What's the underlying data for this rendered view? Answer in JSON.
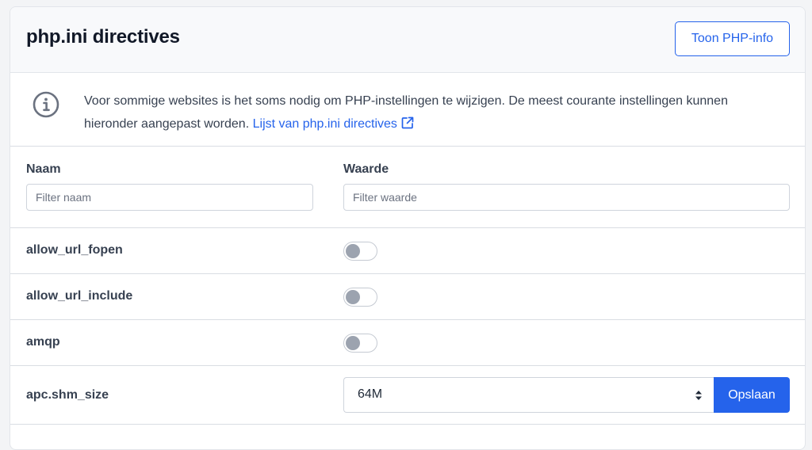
{
  "header": {
    "title": "php.ini directives",
    "php_info_button": "Toon PHP-info"
  },
  "info": {
    "icon": "info-circle-icon",
    "text": "Voor sommige websites is het soms nodig om PHP-instellingen te wijzigen. De meest courante instellingen kunnen hieronder aangepast worden.",
    "link_text": "Lijst van php.ini directives",
    "link_icon": "external-link-icon"
  },
  "filters": {
    "name_label": "Naam",
    "value_label": "Waarde",
    "name_placeholder": "Filter naam",
    "value_placeholder": "Filter waarde"
  },
  "directives": [
    {
      "name": "allow_url_fopen",
      "type": "toggle",
      "enabled": false
    },
    {
      "name": "allow_url_include",
      "type": "toggle",
      "enabled": false
    },
    {
      "name": "amqp",
      "type": "toggle",
      "enabled": false
    },
    {
      "name": "apc.shm_size",
      "type": "select",
      "value": "64M",
      "save_label": "Opslaan"
    }
  ],
  "colors": {
    "accent": "#2563eb",
    "toggle_off": "#9ca3af"
  }
}
